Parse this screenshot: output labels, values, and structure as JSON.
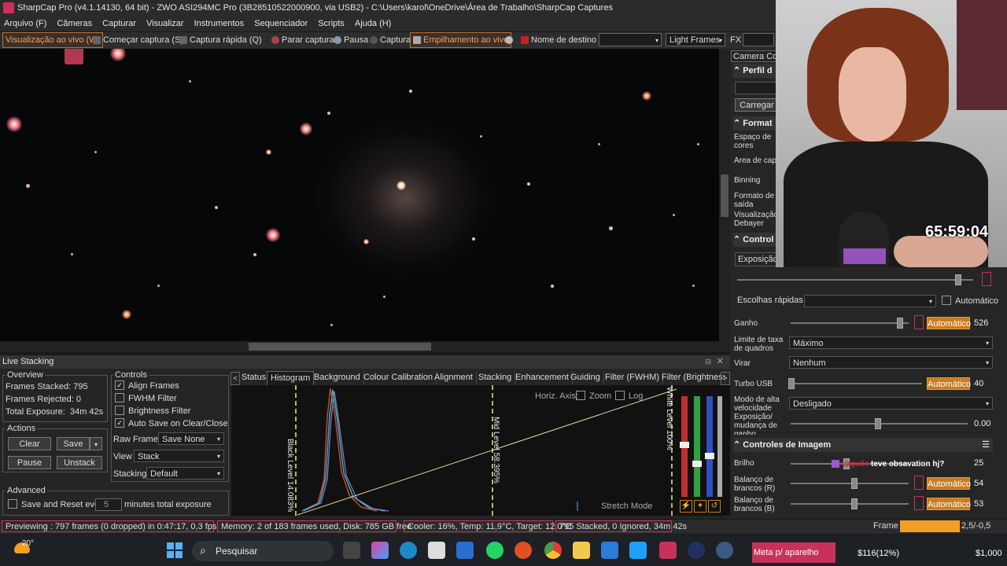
{
  "window": {
    "title": "SharpCap Pro (v4.1.14130, 64 bit) - ZWO ASI294MC Pro (3B28510522000900, via USB2) - C:\\Users\\karol\\OneDrive\\Área de Trabalho\\SharpCap Captures"
  },
  "menu": [
    "Arquivo (F)",
    "Câmeras",
    "Capturar",
    "Visualizar",
    "Instrumentos",
    "Sequenciador",
    "Scripts",
    "Ajuda (H)"
  ],
  "toolbar": {
    "live_view": "Visualização ao vivo (W)",
    "start_capture": "Começar captura (S)",
    "quick_capture": "Captura rápida (Q)",
    "stop_capture": "Parar captura",
    "pause": "Pausa",
    "capture": "Captura",
    "live_stacking": "Empilhamento ao vivo",
    "target_name": "Nome de destino",
    "target_value": "",
    "light_frames": "Light Frames",
    "fx": "FX"
  },
  "live_stacking": {
    "title": "Live Stacking",
    "overview": {
      "label": "Overview",
      "frames_stacked_label": "Frames Stacked:",
      "frames_stacked": "795",
      "frames_rejected_label": "Frames Rejected:",
      "frames_rejected": "0",
      "total_exposure_label": "Total Exposure:",
      "total_exposure": "34m 42s"
    },
    "actions": {
      "label": "Actions",
      "clear": "Clear",
      "save": "Save",
      "pause": "Pause",
      "unstack": "Unstack"
    },
    "advanced": {
      "label": "Advanced",
      "save_reset": "Save and Reset every",
      "minutes": "5",
      "minutes_label": "minutes total exposure"
    },
    "controls": {
      "label": "Controls",
      "align_frames": "Align Frames",
      "fwhm_filter": "FWHM Filter",
      "brightness_filter": "Brightness Filter",
      "auto_save": "Auto Save on Clear/Close",
      "raw_frames_label": "Raw Frames",
      "raw_frames": "Save None",
      "view_label": "View",
      "view": "Stack",
      "stacking_label": "Stacking",
      "stacking": "Default"
    },
    "tabs": [
      "Status",
      "Histogram",
      "Background",
      "Colour Calibration",
      "Alignment",
      "Stacking",
      "Enhancement",
      "Guiding",
      "Filter (FWHM)",
      "Filter (Brightness"
    ],
    "histogram": {
      "horiz_axis": "Horiz. Axis:",
      "zoom": "Zoom",
      "log": "Log",
      "black_level": "Black Level 14.083%",
      "mid_level": "Mid Level 58.395%",
      "white_level": "White Level 100%",
      "stretch_mode": "Stretch Mode"
    }
  },
  "right_panel": {
    "camera_tab": "Camera Con",
    "profile_header": "Perfil d",
    "load_button": "Carregar",
    "format_header": "Format",
    "color_space": "Espaço de cores",
    "capture_area": "Área de capt",
    "binning": "Binning",
    "output_format": "Formato de saída",
    "debayer": "Visualização Debayer",
    "controls_header": "Control",
    "exposure": "Exposição",
    "quick_choices": "Escolhas rápidas",
    "automatic": "Automático",
    "gain_label": "Ganho",
    "gain_auto": "Automático",
    "gain_value": "526",
    "frame_rate_label": "Limite de taxa de quadros",
    "frame_rate_value": "Máximo",
    "flip_label": "Virar",
    "flip_value": "Nenhum",
    "usb_label": "Turbo USB",
    "usb_auto": "Automático",
    "usb_value": "40",
    "high_speed_label": "Modo de alta velocidade",
    "high_speed_value": "Desligado",
    "exposure_change_label": "Exposição/ mudança de ganho",
    "exposure_change_value": "0.00",
    "image_controls_header": "Controles de Imagem",
    "brightness_label": "Brilho",
    "brightness_value": "25",
    "wb_r_label": "Balanço de brancos (R)",
    "wb_r_auto": "Automático",
    "wb_r_value": "54",
    "wb_b_label": "Balanço de brancos (B)",
    "wb_b_auto": "Automático",
    "wb_b_value": "53"
  },
  "overlay": {
    "timer": "65:59:04",
    "chat_user": "vaguile",
    "chat_message": "teve obsavation hj?"
  },
  "statusbar": {
    "previewing": "Previewing : 797 frames (0 dropped) in 0:47:17, 0,3 fps",
    "memory": "Memory: 2 of 183 frames used, Disk: 785 GB free",
    "cooler": "Cooler: 16%, Temp: 11,9°C, Target: 12,0°C",
    "stacked": "795 Stacked, 0 Ignored, 34m 42s",
    "frame_label": "Frame :",
    "frame_extra": "2,5/-0,5"
  },
  "taskbar": {
    "weather": "20°",
    "search": "Pesquisar",
    "notification": "Meta p/ aparelho",
    "goal_value": "$116(12%)",
    "goal_total": "$1,000"
  },
  "colors": {
    "accent": "#c87c1e",
    "highlight_border": "#c8315a",
    "background": "#060709"
  }
}
